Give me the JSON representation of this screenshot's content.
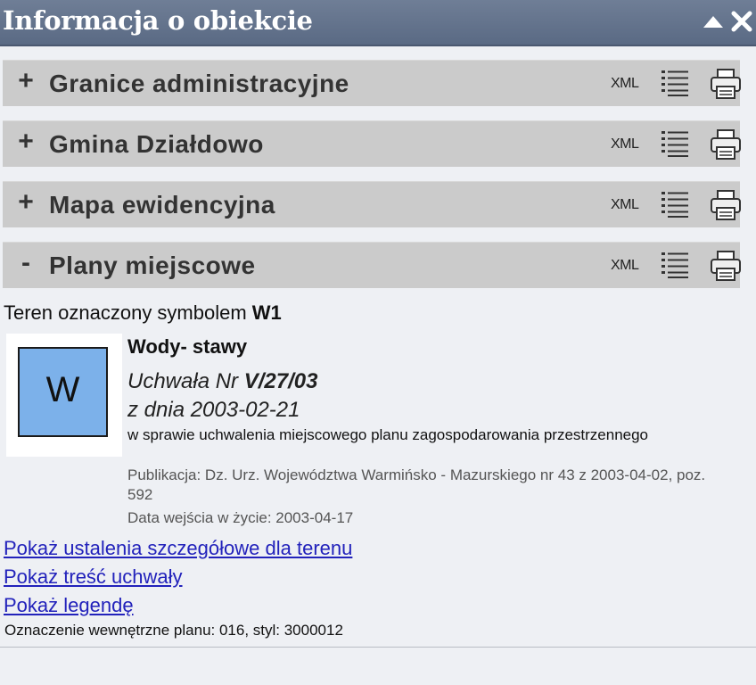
{
  "window": {
    "title": "Informacja o obiekcie"
  },
  "sections": [
    {
      "toggle": "+",
      "label": "Granice administracyjne",
      "xml": "XML"
    },
    {
      "toggle": "+",
      "label": "Gmina Działdowo",
      "xml": "XML"
    },
    {
      "toggle": "+",
      "label": "Mapa ewidencyjna",
      "xml": "XML"
    },
    {
      "toggle": "-",
      "label": "Plany miejscowe",
      "xml": "XML"
    }
  ],
  "content": {
    "symbol_prefix": "Teren oznaczony symbolem ",
    "symbol": "W1",
    "legend_letter": "W",
    "legend_color": "#7cb1ea",
    "name": "Wody- stawy",
    "resolution_prefix": "Uchwała Nr ",
    "resolution_number": "V/27/03",
    "resolution_date": "z dnia 2003-02-21",
    "subject": "w sprawie uchwalenia miejscowego planu zagospodarowania przestrzennego",
    "publication": "Publikacja: Dz. Urz. Województwa Warmińsko - Mazurskiego nr 43 z 2003-04-02, poz. 592",
    "entry_into_force": "Data wejścia w życie: 2003-04-17",
    "links": {
      "details": "Pokaż ustalenia szczegółowe dla terenu",
      "resolution_text": "Pokaż treść uchwały",
      "legend": "Pokaż legendę"
    },
    "internal_designation": "Oznaczenie wewnętrzne planu: 016, styl: 3000012"
  },
  "icons": {
    "collapse": "triangle-up-icon",
    "close": "close-icon",
    "list": "list-icon",
    "print": "printer-icon"
  }
}
